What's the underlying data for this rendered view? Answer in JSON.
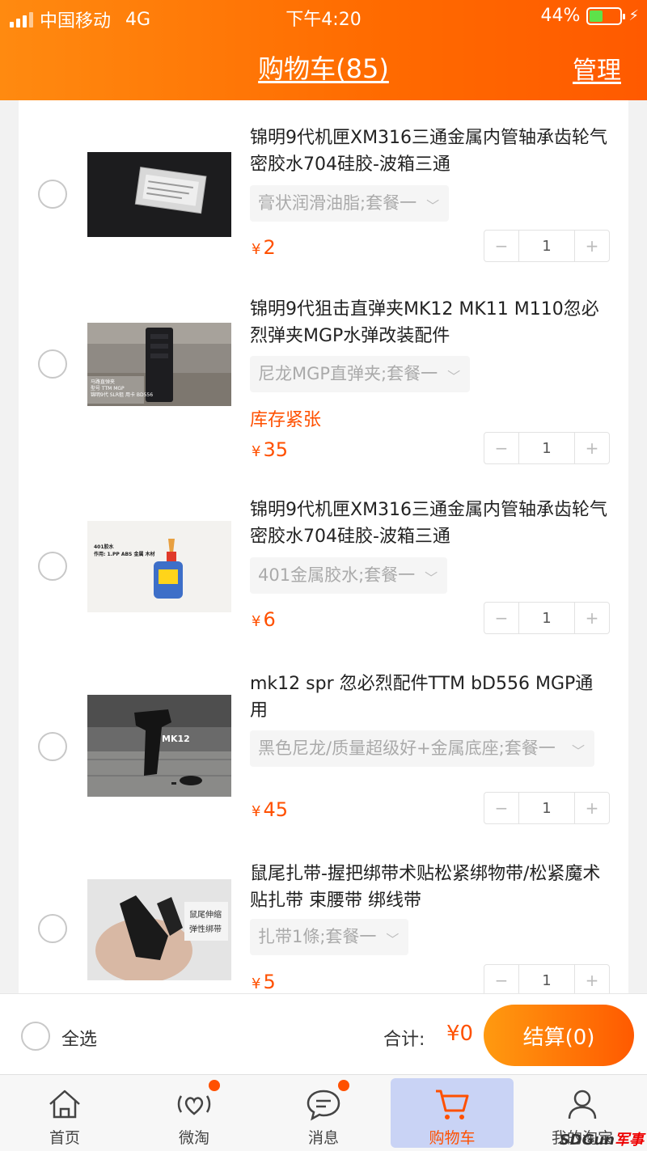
{
  "status_bar": {
    "carrier": "中国移动",
    "network": "4G",
    "time": "下午4:20",
    "battery": "44%",
    "battery_level": 0.44
  },
  "header": {
    "title": "购物车(85)",
    "manage": "管理"
  },
  "items": [
    {
      "title": "锦明9代机匣XM316三通金属内管轴承齿轮气密胶水704硅胶-波箱三通",
      "sku": "膏状润滑油脂;套餐一",
      "stock": "",
      "price": "2",
      "qty": "1"
    },
    {
      "title": "锦明9代狙击直弹夹MK12 MK11 M110忽必烈弹夹MGP水弹改装配件",
      "sku": "尼龙MGP直弹夹;套餐一",
      "stock": "库存紧张",
      "price": "35",
      "qty": "1",
      "thumb_text": [
        "马路直弹夹",
        "型号 TTM MGP",
        "锦明9代 SLR狙 用卡 BD556"
      ]
    },
    {
      "title": "锦明9代机匣XM316三通金属内管轴承齿轮气密胶水704硅胶-波箱三通",
      "sku": "401金属胶水;套餐一",
      "stock": "",
      "price": "6",
      "qty": "1",
      "thumb_text": [
        "401胶水",
        "作用: 1.PP ABS 金属 木材"
      ]
    },
    {
      "title": "mk12 spr 忽必烈配件TTM bD556 MGP通用",
      "sku": "黑色尼龙/质量超级好+金属底座;套餐一",
      "stock": "",
      "price": "45",
      "qty": "1",
      "thumb_text": [
        "MK12"
      ]
    },
    {
      "title": "鼠尾扎带-握把绑带术贴松紧绑物带/松紧魔术贴扎带 束腰带 绑线带",
      "sku": "扎带1條;套餐一",
      "stock": "",
      "price": "5",
      "qty": "1",
      "thumb_text": [
        "鼠尾伸缩",
        "弹性绑带"
      ]
    }
  ],
  "currency": "¥",
  "footer": {
    "select_all": "全选",
    "total_label": "合计:",
    "total_amount": "¥0",
    "checkout": "结算(0)"
  },
  "tabs": [
    {
      "label": "首页",
      "icon": "home-icon"
    },
    {
      "label": "微淘",
      "icon": "heart-signal-icon"
    },
    {
      "label": "消息",
      "icon": "chat-bubble-icon"
    },
    {
      "label": "购物车",
      "icon": "cart-icon"
    },
    {
      "label": "我的淘宝",
      "icon": "user-icon"
    }
  ],
  "watermark": {
    "text": "SDGun",
    "suffix": "军事"
  },
  "colors": {
    "accent": "#ff5000",
    "header": "#ff7a00",
    "active_tab_bg": "#c9d3f5"
  }
}
